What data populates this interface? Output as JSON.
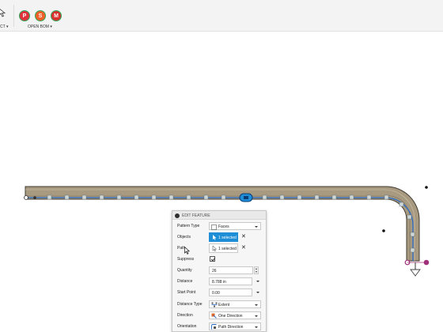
{
  "toolbar": {
    "left_label": "CT",
    "bom_icons": {
      "p": {
        "letter": "P",
        "color": "#e0323a"
      },
      "s": {
        "letter": "S",
        "color": "#ee5f2a"
      },
      "m": {
        "letter": "M",
        "color": "#d9312f"
      }
    },
    "open_bom_label": "OPEN BOM"
  },
  "canvas": {
    "body_color": "#a89a80",
    "path_color": "#2b6dc5",
    "selected_face_color": "#1e8fd6",
    "endpoint_color": "#a0307a"
  },
  "panel": {
    "title": "EDIT FEATURE",
    "pattern_type": {
      "label": "Pattern Type",
      "value": "Faces",
      "icon": "face-icon"
    },
    "objects": {
      "label": "Objects",
      "value": "1 selected",
      "icon": "arrow-cursor-icon"
    },
    "path": {
      "label": "Path",
      "value": "1 selected",
      "icon": "arrow-cursor-icon"
    },
    "suppress": {
      "label": "Suppress",
      "checked": true
    },
    "quantity": {
      "label": "Quantity",
      "value": "26"
    },
    "distance": {
      "label": "Distance",
      "value": "8.788 in"
    },
    "start_point": {
      "label": "Start Point",
      "value": "0.00"
    },
    "distance_type": {
      "label": "Distance Type",
      "value": "Extent",
      "icon": "extent-icon"
    },
    "direction": {
      "label": "Direction",
      "value": "One Direction",
      "icon": "direction-icon"
    },
    "orientation": {
      "label": "Orientation",
      "value": "Path Direction",
      "icon": "path-direction-icon"
    }
  }
}
